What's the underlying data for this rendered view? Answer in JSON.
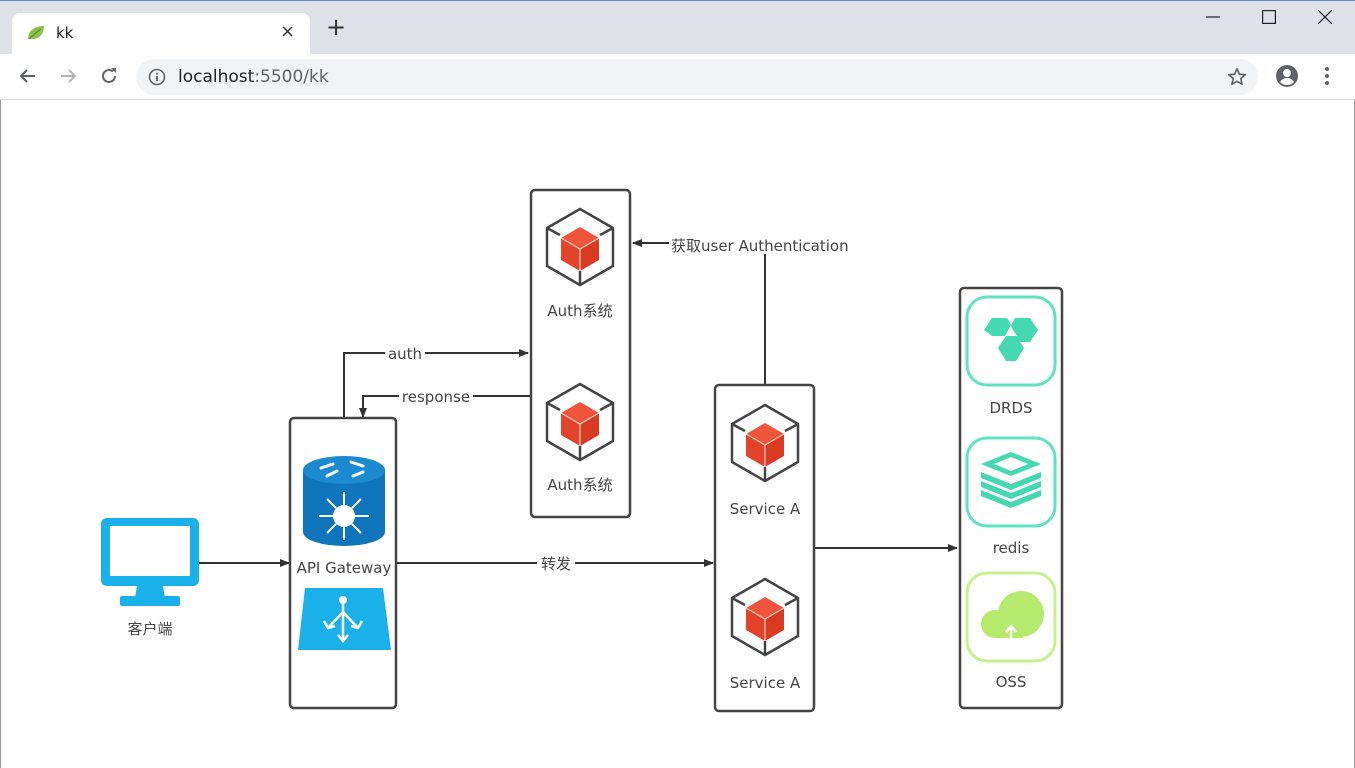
{
  "browser": {
    "tab": {
      "title": "kk",
      "favicon": "spring-leaf-icon",
      "close": "×"
    },
    "new_tab": "+",
    "window_controls": {
      "minimize": "—",
      "maximize": "☐",
      "close": "✕"
    },
    "address": {
      "host": "localhost",
      "rest": ":5500/kk"
    },
    "icons": [
      "back-icon",
      "forward-icon",
      "reload-icon",
      "info-icon",
      "star-icon",
      "profile-icon",
      "menu-icon"
    ]
  },
  "diagram": {
    "client": {
      "label": "客户端",
      "icon": "monitor-icon"
    },
    "gateway": {
      "label": "API Gateway",
      "icons": [
        "router-icon",
        "load-balancer-icon"
      ]
    },
    "auth": {
      "nodes": [
        {
          "label": "Auth系统"
        },
        {
          "label": "Auth系统"
        }
      ]
    },
    "services": {
      "nodes": [
        {
          "label": "Service A"
        },
        {
          "label": "Service A"
        }
      ]
    },
    "storage": {
      "nodes": [
        {
          "label": "DRDS"
        },
        {
          "label": "redis"
        },
        {
          "label": "OSS"
        }
      ]
    },
    "edges": {
      "auth": "auth",
      "response": "response",
      "forward": "转发",
      "get_auth": "获取user Authentication"
    }
  }
}
